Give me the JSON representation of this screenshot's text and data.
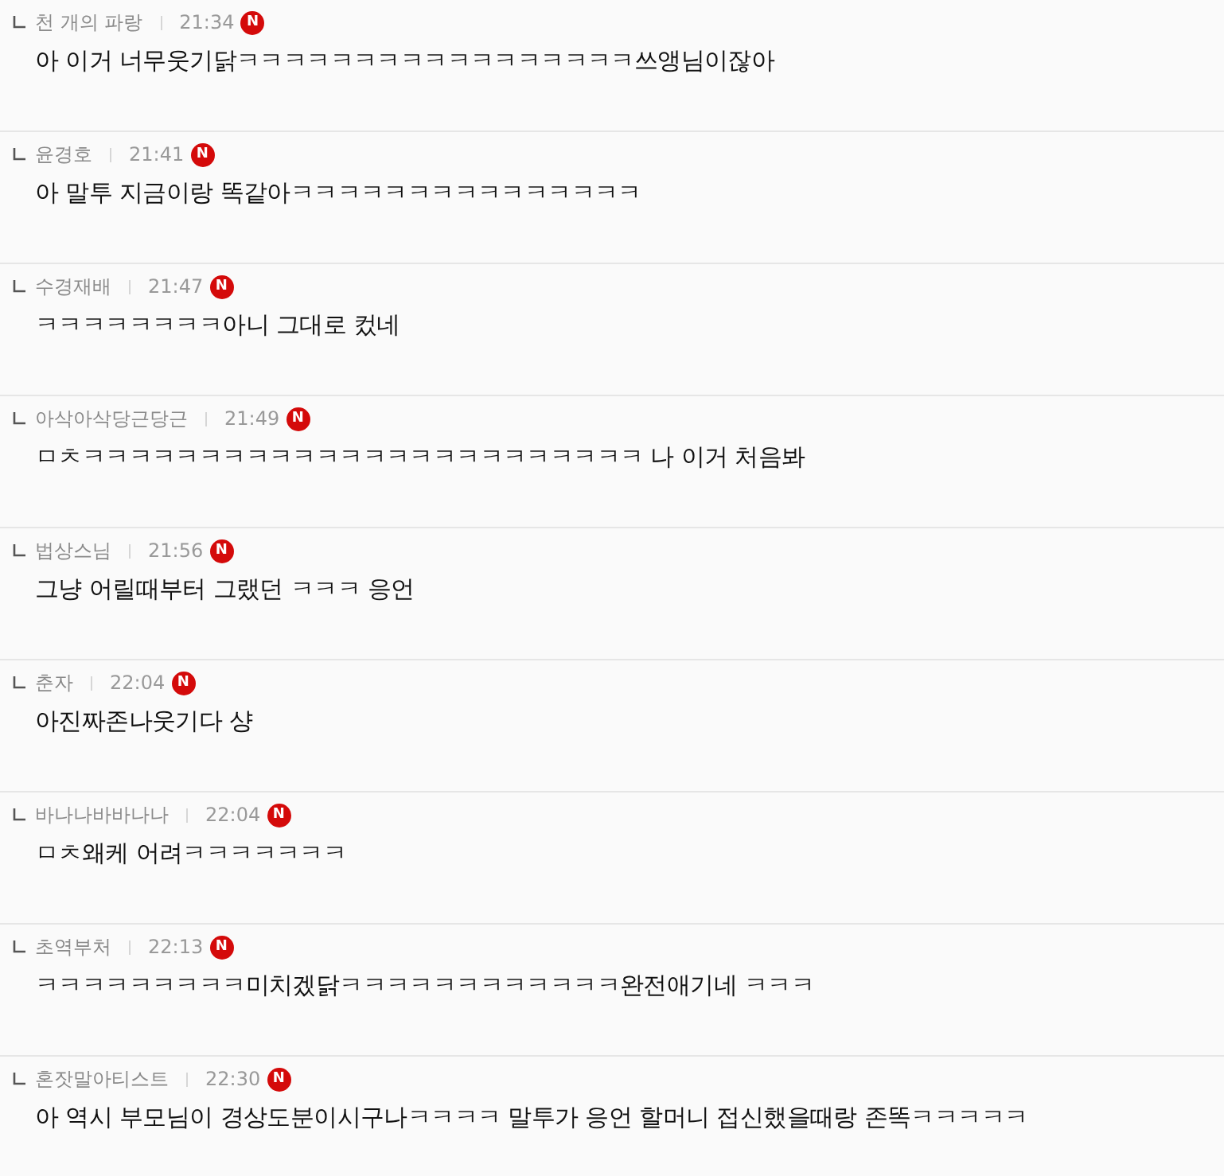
{
  "comments": [
    {
      "author": "천 개의 파랑",
      "time": "21:34",
      "badge": "N",
      "text": "아 이거 너무웃기닭ㅋㅋㅋㅋㅋㅋㅋㅋㅋㅋㅋㅋㅋㅋㅋㅋㅋ쓰앵님이잖아"
    },
    {
      "author": "윤경호",
      "time": "21:41",
      "badge": "N",
      "text": "아 말투 지금이랑 똑같아ㅋㅋㅋㅋㅋㅋㅋㅋㅋㅋㅋㅋㅋㅋㅋ"
    },
    {
      "author": "수경재배",
      "time": "21:47",
      "badge": "N",
      "text": "ㅋㅋㅋㅋㅋㅋㅋㅋ아니 그대로 컸네"
    },
    {
      "author": "아삭아삭당근당근",
      "time": "21:49",
      "badge": "N",
      "text": "ㅁㅊㅋㅋㅋㅋㅋㅋㅋㅋㅋㅋㅋㅋㅋㅋㅋㅋㅋㅋㅋㅋㅋㅋㅋㅋ 나 이거 처음봐"
    },
    {
      "author": "법상스님",
      "time": "21:56",
      "badge": "N",
      "text": "그냥 어릴때부터 그랬던 ㅋㅋㅋ 응언"
    },
    {
      "author": "춘자",
      "time": "22:04",
      "badge": "N",
      "text": "아진짜존나웃기다 샹"
    },
    {
      "author": "바나나바바나나",
      "time": "22:04",
      "badge": "N",
      "text": "ㅁㅊ왜케 어려ㅋㅋㅋㅋㅋㅋㅋ"
    },
    {
      "author": "초역부처",
      "time": "22:13",
      "badge": "N",
      "text": "ㅋㅋㅋㅋㅋㅋㅋㅋㅋ미치겠닭ㅋㅋㅋㅋㅋㅋㅋㅋㅋㅋㅋㅋ완전애기네 ㅋㅋㅋ"
    },
    {
      "author": "혼잣말아티스트",
      "time": "22:30",
      "badge": "N",
      "text": "아 역시 부모님이 경상도분이시구나ㅋㅋㅋㅋ 말투가 응언 할머니 접신했을때랑 존똑ㅋㅋㅋㅋㅋ"
    }
  ]
}
